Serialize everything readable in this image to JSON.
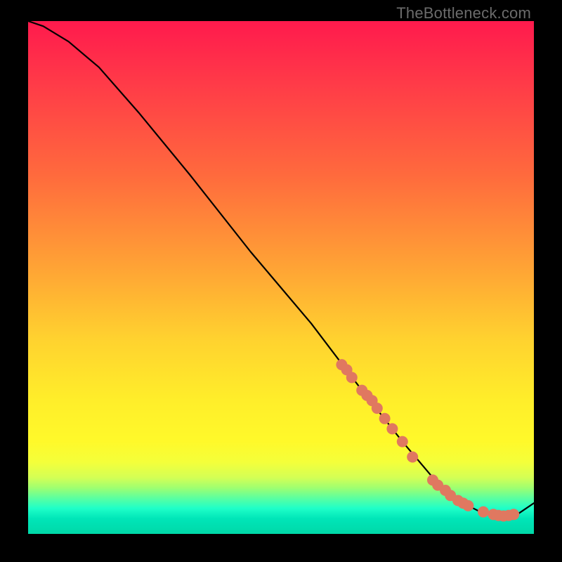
{
  "watermark": "TheBottleneck.com",
  "colors": {
    "dot": "#e07860",
    "curve": "#000000",
    "gradient_top": "#ff1a4d",
    "gradient_bottom": "#00d8a8"
  },
  "chart_data": {
    "type": "line",
    "title": "",
    "xlabel": "",
    "ylabel": "",
    "xlim": [
      0,
      100
    ],
    "ylim": [
      0,
      100
    ],
    "grid": false,
    "legend": false,
    "note": "No axes or tick labels are visible; values are proportional estimates read from pixel geometry (0–100 each axis, origin bottom-left).",
    "series": [
      {
        "name": "curve",
        "kind": "line",
        "x": [
          0,
          3,
          8,
          14,
          22,
          32,
          44,
          56,
          66,
          74,
          80,
          86,
          90,
          94,
          97,
          100
        ],
        "y": [
          100,
          99,
          96,
          91,
          82,
          70,
          55,
          41,
          28,
          18,
          11,
          6,
          4,
          3.5,
          4,
          6
        ]
      },
      {
        "name": "highlighted-points",
        "kind": "scatter",
        "x": [
          62,
          63,
          64,
          66,
          67,
          68,
          69,
          70.5,
          72,
          74,
          76,
          80,
          81,
          82.5,
          83.5,
          85,
          86,
          87,
          90,
          92,
          93,
          94,
          95,
          96
        ],
        "y": [
          33,
          32,
          30.5,
          28,
          27,
          26,
          24.5,
          22.5,
          20.5,
          18,
          15,
          10.5,
          9.5,
          8.5,
          7.5,
          6.5,
          6,
          5.5,
          4.3,
          3.8,
          3.6,
          3.5,
          3.6,
          3.8
        ],
        "marker_radius": 8
      }
    ]
  }
}
